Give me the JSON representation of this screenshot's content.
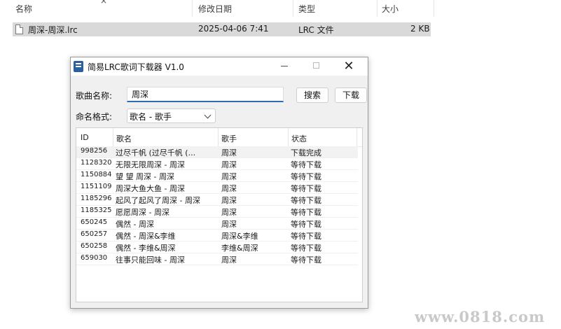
{
  "explorer": {
    "columns": [
      "名称",
      "修改日期",
      "类型",
      "大小"
    ],
    "file": {
      "name": "周深-周深.lrc",
      "modified": "2025-04-06 7:41",
      "type": "LRC 文件",
      "size": "2 KB"
    }
  },
  "dialog": {
    "title": "简易LRC歌词下载器 V1.0",
    "song_label": "歌曲名称:",
    "song_value": "周深",
    "search_button": "搜索",
    "download_button": "下载",
    "naming_label": "命名格式:",
    "naming_value": "歌名 - 歌手",
    "list": {
      "headers": [
        "ID",
        "歌名",
        "歌手",
        "状态"
      ],
      "rows": [
        {
          "id": "998256",
          "name": "过尽千帆 (过尽千帆 (...",
          "artist": "周深",
          "status": "下载完成"
        },
        {
          "id": "1128320",
          "name": "无限无限周深 - 周深",
          "artist": "周深",
          "status": "等待下载"
        },
        {
          "id": "1150884",
          "name": "望 望 周深 - 周深",
          "artist": "周深",
          "status": "等待下载"
        },
        {
          "id": "1151109",
          "name": "周深大鱼大鱼 - 周深",
          "artist": "周深",
          "status": "等待下载"
        },
        {
          "id": "1185296",
          "name": "起风了起风了周深 - 周深",
          "artist": "周深",
          "status": "等待下载"
        },
        {
          "id": "1185325",
          "name": "愿愿周深 - 周深",
          "artist": "周深",
          "status": "等待下载"
        },
        {
          "id": "650245",
          "name": "偶然 - 周深",
          "artist": "周深",
          "status": "等待下载"
        },
        {
          "id": "650257",
          "name": "偶然 - 周深&李维",
          "artist": "周深&李维",
          "status": "等待下载"
        },
        {
          "id": "650258",
          "name": "偶然 - 李维&周深",
          "artist": "李维&周深",
          "status": "等待下载"
        },
        {
          "id": "659030",
          "name": "往事只能回味 - 周深",
          "artist": "周深",
          "status": "等待下载"
        }
      ]
    }
  },
  "watermark": "www.0818.com"
}
